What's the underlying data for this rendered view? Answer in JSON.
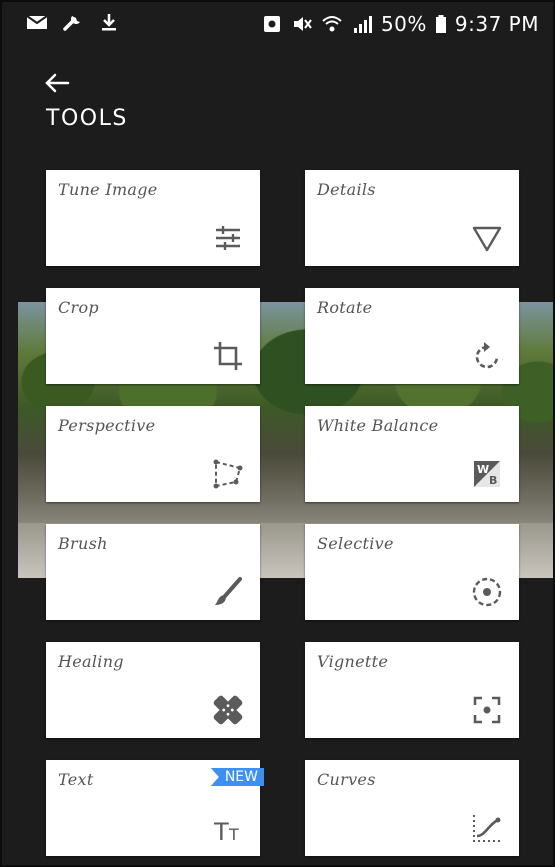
{
  "status": {
    "battery": "50%",
    "time": "9:37 PM",
    "icons_left": [
      "mail-icon",
      "wrench-icon",
      "download-icon"
    ],
    "icons_right": [
      "nfc-icon",
      "mute-icon",
      "wifi-icon",
      "signal-icon",
      "battery-icon"
    ]
  },
  "header": {
    "title": "TOOLS",
    "back_icon": "arrow-left-icon"
  },
  "tools": [
    {
      "label": "Tune Image",
      "icon": "sliders-icon"
    },
    {
      "label": "Details",
      "icon": "triangle-down-icon"
    },
    {
      "label": "Crop",
      "icon": "crop-icon"
    },
    {
      "label": "Rotate",
      "icon": "rotate-icon"
    },
    {
      "label": "Perspective",
      "icon": "perspective-icon"
    },
    {
      "label": "White Balance",
      "icon": "white-balance-icon"
    },
    {
      "label": "Brush",
      "icon": "brush-icon"
    },
    {
      "label": "Selective",
      "icon": "selective-icon"
    },
    {
      "label": "Healing",
      "icon": "bandage-icon"
    },
    {
      "label": "Vignette",
      "icon": "vignette-icon"
    },
    {
      "label": "Text",
      "icon": "text-size-icon",
      "badge": "NEW"
    },
    {
      "label": "Curves",
      "icon": "curves-icon"
    }
  ],
  "icon_texts": {
    "white_balance": [
      "W",
      "B"
    ],
    "text_size": [
      "T",
      "T"
    ]
  },
  "colors": {
    "background": "#1c1c1c",
    "card": "#ffffff",
    "icon": "#5b5b5b",
    "badge": "#3d8ff0"
  }
}
